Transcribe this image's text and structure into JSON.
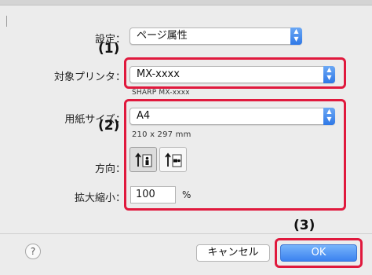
{
  "settings": {
    "label": "設定：",
    "value": "ページ属性"
  },
  "printer": {
    "label": "対象プリンタ：",
    "value": "MX-xxxx",
    "sub": "SHARP MX-xxxx"
  },
  "paper": {
    "label": "用紙サイズ：",
    "value": "A4",
    "dims": "210 x 297 mm"
  },
  "orientation": {
    "label": "方向：",
    "selected": "portrait"
  },
  "scale": {
    "label": "拡大縮小：",
    "value": "100",
    "unit": "%"
  },
  "callouts": {
    "c1": "(1)",
    "c2": "(2)",
    "c3": "(3)"
  },
  "buttons": {
    "help": "?",
    "cancel": "キャンセル",
    "ok": "OK"
  },
  "colors": {
    "highlight": "#e0193d",
    "accent": "#3b82ef"
  }
}
